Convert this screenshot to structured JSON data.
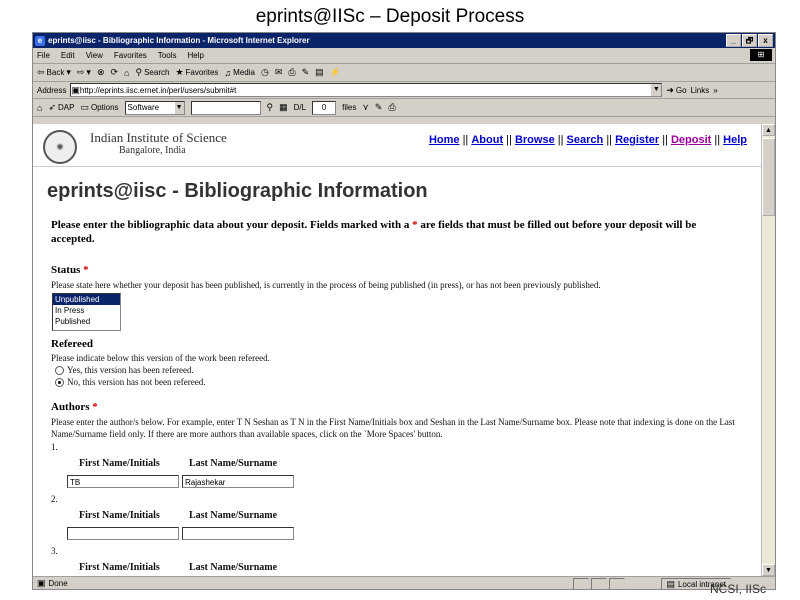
{
  "slide": {
    "title": "eprints@IISc – Deposit Process",
    "footer": "NCSI, IISc"
  },
  "window": {
    "title": "eprints@iisc - Bibliographic Information - Microsoft Internet Explorer",
    "buttons": [
      "_",
      "🗗",
      "x"
    ]
  },
  "menu": [
    "File",
    "Edit",
    "View",
    "Favorites",
    "Tools",
    "Help"
  ],
  "toolbar": {
    "back": "Back",
    "search": "Search",
    "favorites": "Favorites",
    "media": "Media"
  },
  "address": {
    "label": "Address",
    "url": "http://eprints.iisc.ernet.in/perl/users/submit#t",
    "go": "Go",
    "links": "Links"
  },
  "toolbar2": {
    "dap": "DAP",
    "options": "Options",
    "software": "Software",
    "dl_label": "D/L",
    "dl_count": "0",
    "files_label": "files"
  },
  "site": {
    "institute": "Indian Institute of Science",
    "location": "Bangalore, India",
    "nav": {
      "home": "Home",
      "about": "About",
      "browse": "Browse",
      "search": "Search",
      "register": "Register",
      "deposit": "Deposit",
      "help": "Help",
      "sep": "||"
    }
  },
  "page": {
    "heading": "eprints@iisc - Bibliographic Information",
    "intro_a": "Please enter the bibliographic data about your deposit. Fields marked with a ",
    "intro_star": "*",
    "intro_b": " are fields that must be filled out before your deposit will be accepted."
  },
  "status": {
    "title": "Status",
    "star": "*",
    "help": "Please state here whether your deposit has been published, is currently in the process of being published (in press), or has not been previously published.",
    "options": [
      "Unpublished",
      "In Press",
      "Published"
    ],
    "selected": "Unpublished"
  },
  "refereed": {
    "title": "Refereed",
    "help": "Please indicate below this version of the work been refereed.",
    "yes": "Yes, this version has been refereed.",
    "no": "No, this version has not been refereed.",
    "selected": "no"
  },
  "authors": {
    "title": "Authors",
    "star": "*",
    "help": "Please enter the author/s below. For example, enter T N Seshan as T N in the First Name/Initials box and Seshan in the Last Name/Surname box. Please note that indexing is done on the Last Name/Surname field only. If there are more authors than available spaces, click on the `More Spaces' button.",
    "col_first": "First Name/Initials",
    "col_last": "Last Name/Surname",
    "entries": [
      {
        "num": "1.",
        "first": "TB",
        "last": "Rajashekar"
      },
      {
        "num": "2.",
        "first": "",
        "last": ""
      },
      {
        "num": "3.",
        "first": "",
        "last": ""
      }
    ]
  },
  "statusbar": {
    "left": "Done",
    "zone": "Local intranet"
  }
}
